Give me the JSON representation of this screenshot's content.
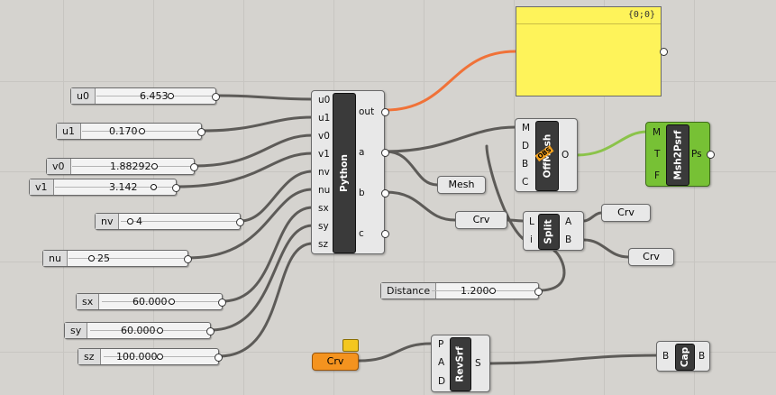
{
  "colors": {
    "canvas": "#d5d3cf",
    "wire": "#5d5b58",
    "wire_selected": "#f07238",
    "wire_green": "#8bc34a",
    "panel": "#fef35a",
    "msh2psrf": "#77c135",
    "crv_param": "#f4931f"
  },
  "sliders": [
    {
      "name": "u0",
      "value": "6.453"
    },
    {
      "name": "u1",
      "value": "0.170"
    },
    {
      "name": "v0",
      "value": "1.88292"
    },
    {
      "name": "v1",
      "value": "3.142"
    },
    {
      "name": "nv",
      "value": "4"
    },
    {
      "name": "nu",
      "value": "25"
    },
    {
      "name": "sx",
      "value": "60.000"
    },
    {
      "name": "sy",
      "value": "60.000"
    },
    {
      "name": "sz",
      "value": "100.000"
    },
    {
      "name": "Distance",
      "value": "1.200"
    }
  ],
  "python": {
    "title": "Python",
    "inputs": [
      "u0",
      "u1",
      "v0",
      "v1",
      "nv",
      "nu",
      "sx",
      "sy",
      "sz"
    ],
    "outputs": [
      "out",
      "a",
      "b",
      "c"
    ]
  },
  "panel": {
    "text": "{0;0}"
  },
  "offset_mesh": {
    "title": "OffMesh",
    "inputs": [
      "M",
      "D",
      "B",
      "C"
    ],
    "outputs": [
      "O"
    ],
    "badge": "OBS"
  },
  "msh2psrf": {
    "title": "Msh2Psrf",
    "inputs": [
      "M",
      "T",
      "F"
    ],
    "outputs": [
      "Ps"
    ]
  },
  "split": {
    "title": "Split",
    "inputs": [
      "L",
      "i"
    ],
    "outputs": [
      "A",
      "B"
    ]
  },
  "revsrf": {
    "title": "RevSrf",
    "inputs": [
      "P",
      "A",
      "D"
    ],
    "outputs": [
      "S"
    ]
  },
  "cap": {
    "title": "Cap",
    "inputs": [
      "B"
    ],
    "outputs": [
      "B"
    ]
  },
  "params": {
    "mesh": "Mesh",
    "crv_mid": "Crv",
    "crv_a": "Crv",
    "crv_b": "Crv",
    "crv_orange": "Crv"
  }
}
